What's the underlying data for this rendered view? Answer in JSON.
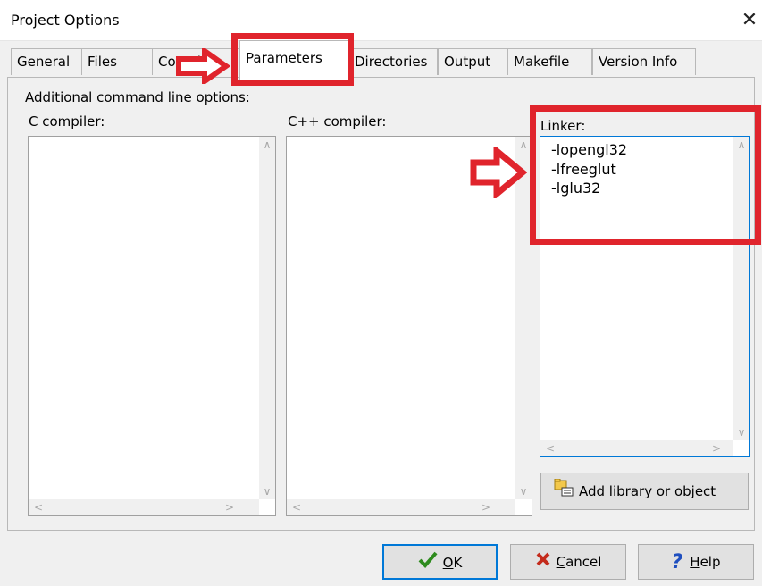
{
  "window": {
    "title": "Project Options",
    "close_glyph": "✕"
  },
  "tabs": [
    "General",
    "Files",
    "Compiler",
    "Parameters",
    "Directories",
    "Output",
    "Makefile",
    "Version Info"
  ],
  "active_tab": "Parameters",
  "section_label": "Additional command line options:",
  "c_compiler": {
    "label": "C compiler:",
    "value": ""
  },
  "cpp_compiler": {
    "label": "C++ compiler:",
    "value": ""
  },
  "linker": {
    "label": "Linker:",
    "value": "-lopengl32\n-lfreeglut\n-lglu32"
  },
  "add_library_button": "Add library or object",
  "footer": {
    "ok": {
      "mnemonic": "O",
      "rest": "K"
    },
    "cancel": {
      "mnemonic": "C",
      "rest": "ancel"
    },
    "help": {
      "mnemonic": "H",
      "rest": "elp"
    }
  },
  "colors": {
    "annotation_red": "#e0242c",
    "focus_blue": "#0078d7",
    "ok_check": "#2e8b1e",
    "cancel_x": "#c42b1c",
    "help_q": "#1f4fbf"
  }
}
